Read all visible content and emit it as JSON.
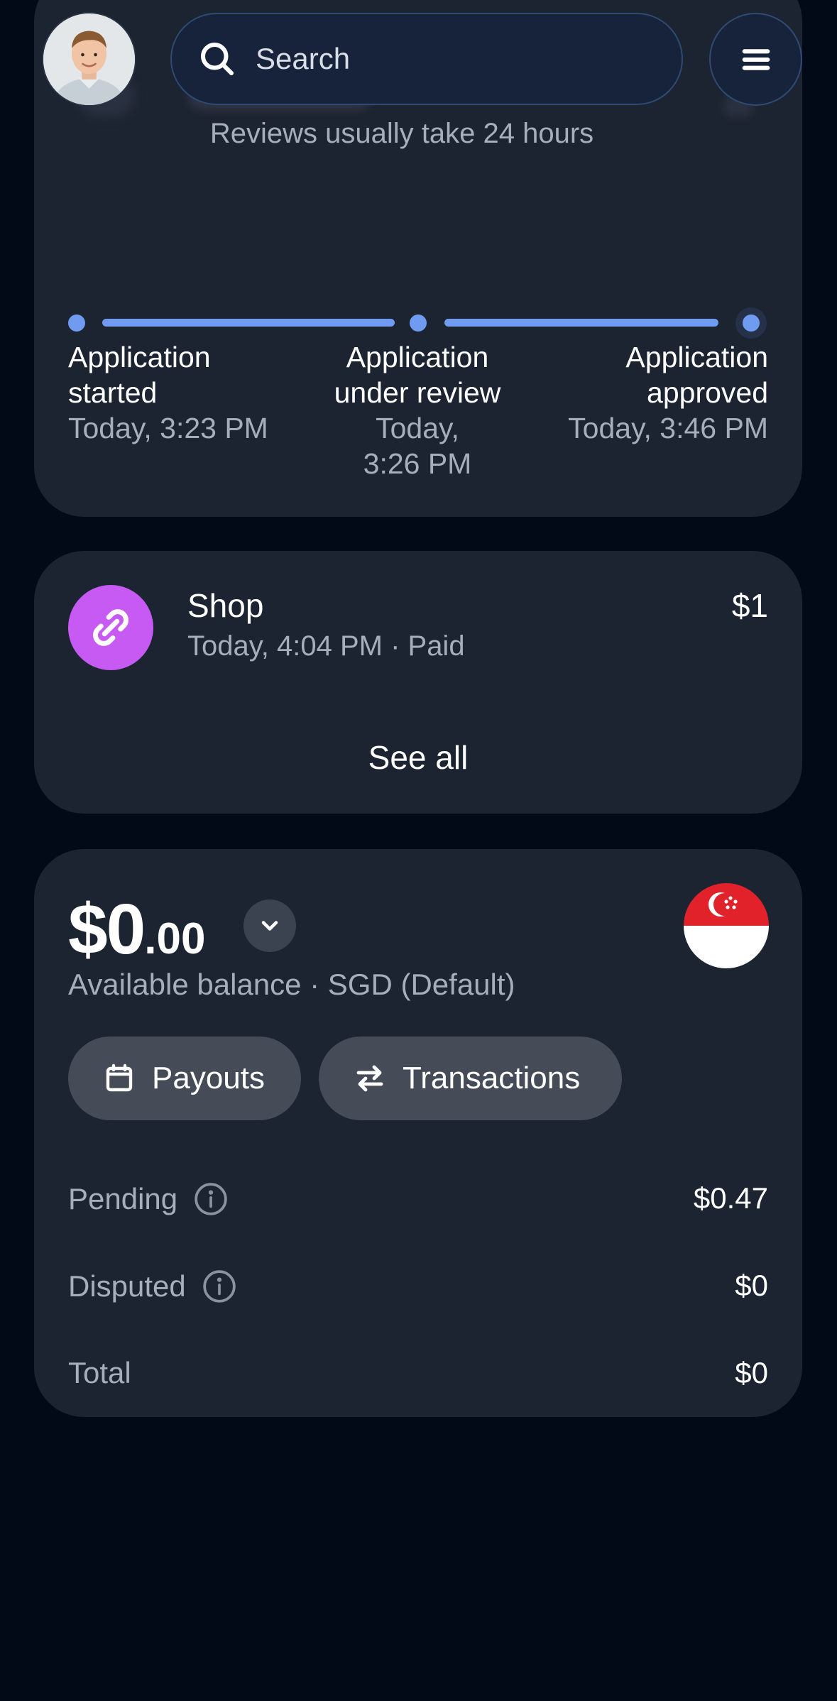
{
  "header": {
    "search_placeholder": "Search"
  },
  "review_card": {
    "note": "Reviews usually take 24 hours",
    "steps": [
      {
        "title_line1": "Application",
        "title_line2": "started",
        "date_line1": "Today, 3:23 PM",
        "date_line2": ""
      },
      {
        "title_line1": "Application",
        "title_line2": "under review",
        "date_line1": "Today,",
        "date_line2": "3:26 PM"
      },
      {
        "title_line1": "Application",
        "title_line2": "approved",
        "date_line1": "Today, 3:46 PM",
        "date_line2": ""
      }
    ],
    "accent_color": "#6f9cf0"
  },
  "activity_card": {
    "item": {
      "name": "Shop",
      "meta": "Today, 4:04 PM · Paid",
      "amount": "$1",
      "icon": "link-icon",
      "icon_color": "#c65af2"
    },
    "see_all_label": "See all"
  },
  "balance_card": {
    "amount_whole": "$0",
    "amount_cents": ".00",
    "caption": "Available balance · SGD (Default)",
    "currency_flag": "singapore-flag-icon",
    "payouts_label": "Payouts",
    "transactions_label": "Transactions",
    "rows": [
      {
        "label": "Pending",
        "value": "$0.47",
        "has_info": true
      },
      {
        "label": "Disputed",
        "value": "$0",
        "has_info": true
      },
      {
        "label": "Total",
        "value": "$0",
        "has_info": false
      }
    ]
  }
}
